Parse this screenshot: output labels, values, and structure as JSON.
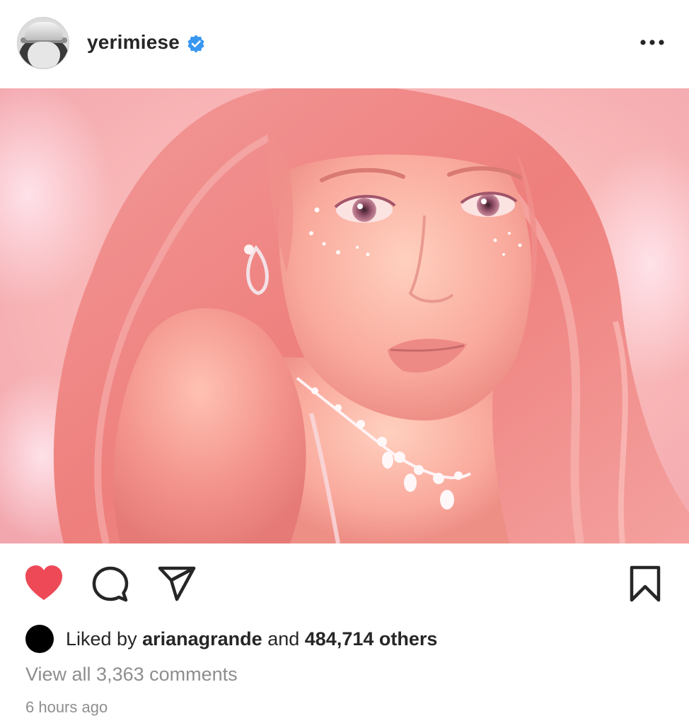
{
  "post": {
    "username": "yerimiese",
    "verified_icon": "verified-badge-icon",
    "more_icon": "more-options-icon"
  },
  "photo": {
    "alt": "photo"
  },
  "actions": {
    "like_icon": "heart-icon",
    "comment_icon": "comment-icon",
    "share_icon": "share-icon",
    "save_icon": "bookmark-icon"
  },
  "likes": {
    "prefix": "Liked by",
    "liker": "arianagrande",
    "connector": "and",
    "count": "484,714 others"
  },
  "comments": {
    "view_all": "View all 3,363 comments"
  },
  "timestamp": "6 hours ago",
  "colors": {
    "liked_heart": "#ed4956",
    "verified_blue": "#3897f0",
    "secondary_text": "#8e8e8e",
    "primary_text": "#262626"
  }
}
